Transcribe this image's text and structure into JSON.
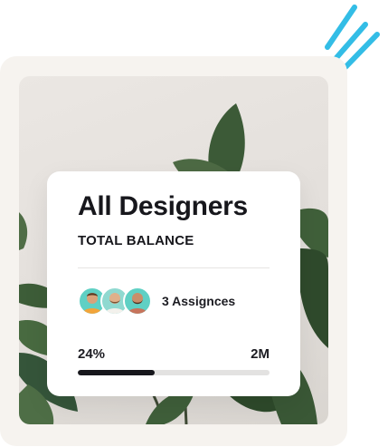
{
  "card": {
    "title": "All Designers",
    "subtitle": "TOTAL BALANCE",
    "assignees_label": "3 Assignces",
    "progress": {
      "percent_label": "24%",
      "total_label": "2M",
      "fill_fraction": 0.4
    },
    "avatars": [
      {
        "name": "avatar-1",
        "bg": "#5fd0c4"
      },
      {
        "name": "avatar-2",
        "bg": "#8fd9d0"
      },
      {
        "name": "avatar-3",
        "bg": "#5fd0c4"
      }
    ]
  },
  "colors": {
    "accent_strokes": "#33bde6",
    "frame_bg": "#f6f3ef",
    "card_bg": "#ffffff",
    "progress_fill": "#17171c",
    "progress_track": "#e3e2e1"
  }
}
